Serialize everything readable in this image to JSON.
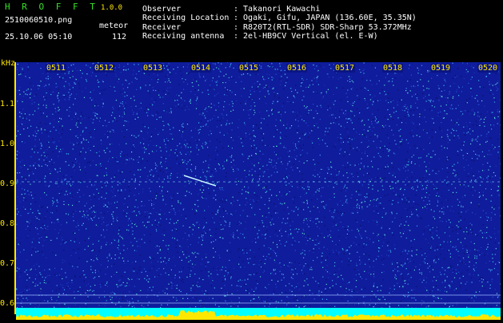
{
  "header": {
    "app_title": "H R O F F T",
    "app_version": "1.0.0",
    "filename": "2510060510.png",
    "datetime": "25.10.06 05:10",
    "meteor_label": "meteor",
    "meteor_count": "112",
    "info": [
      {
        "key": "Observer",
        "value": ": Takanori Kawachi"
      },
      {
        "key": "Receiving Location",
        "value": ": Ogaki, Gifu, JAPAN (136.60E, 35.35N)"
      },
      {
        "key": "Receiver",
        "value": ": R820T2(RTL-SDR) SDR-Sharp 53.372MHz"
      },
      {
        "key": "Receiving antenna",
        "value": ": 2el-HB9CV Vertical (el. E-W)"
      }
    ]
  },
  "axis": {
    "unit": "kHz",
    "y_ticks": [
      "1.1",
      "1.0",
      "0.9",
      "0.8",
      "0.7",
      "0.6"
    ],
    "time_labels": [
      "0511",
      "0512",
      "0513",
      "0514",
      "0515",
      "0516",
      "0517",
      "0518",
      "0519",
      "0520"
    ]
  },
  "colors": {
    "background": "#0f1c9c",
    "label_yellow": "#ffe800",
    "title_green": "#38e028",
    "signal_cyan": "#00ffff"
  }
}
